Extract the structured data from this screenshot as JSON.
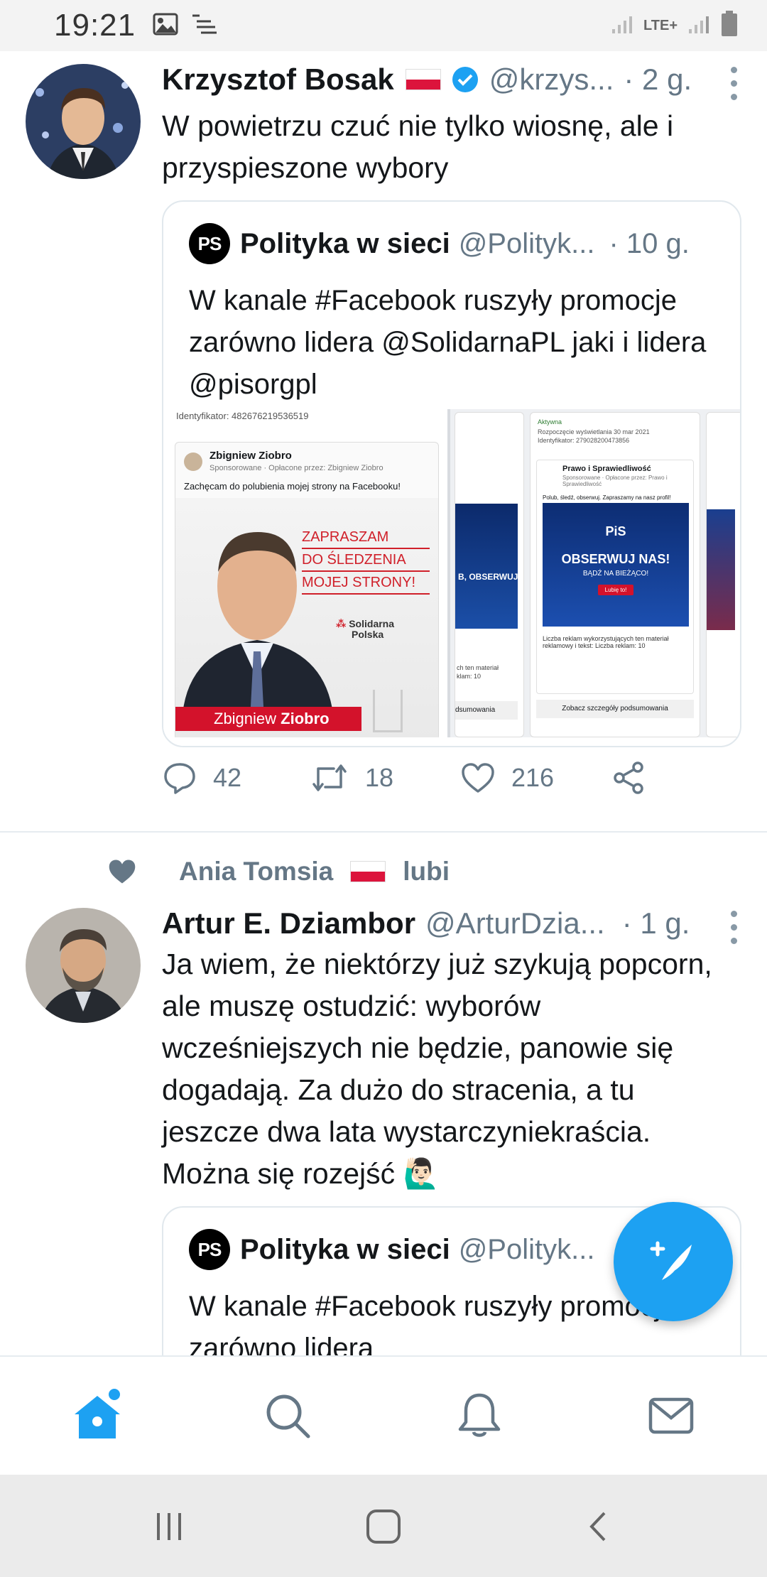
{
  "status_bar": {
    "time": "19:21",
    "network": "LTE+"
  },
  "tweets": [
    {
      "name": "Krzysztof Bosak",
      "handle": "@krzys...",
      "time": "· 2 g.",
      "text": "W powietrzu czuć nie tylko wiosnę, ale i przyspieszone wybory",
      "quote": {
        "name": "Polityka w sieci",
        "handle": "@Polityk...",
        "time": "· 10 g.",
        "logo": "PS",
        "text": "W kanale #Facebook ruszyły promocje zarówno lidera @SolidarnaPL jaki i lidera @pisorgpl",
        "media": {
          "ad1_id": "Identyfikator: 482676219536519",
          "ad1_page": "Zbigniew Ziobro",
          "ad1_sponsored": "Sponsorowane · Opłacone przez: Zbigniew Ziobro",
          "ad1_text": "Zachęcam do polubienia mojej strony na Facebooku!",
          "ad1_banner": [
            "ZAPRASZAM",
            "DO ŚLEDZENIA",
            "MOJEJ STRONY!"
          ],
          "ad1_party": [
            "Solidarna",
            "Polska"
          ],
          "ad1_footer_first": "Zbigniew ",
          "ad1_footer_last": "Ziobro",
          "ad2_button": "B, OBSERWUJ",
          "ad2_footer": "ch ten materiał",
          "ad2_count": "klam: 10",
          "ad2_summary": "dsumowania",
          "ad3_status": "Aktywna",
          "ad3_started": "Rozpoczęcie wyświetlania 30 mar 2021",
          "ad3_id": "Identyfikator: 279028200473856",
          "ad3_page": "Prawo i Sprawiedliwość",
          "ad3_sponsored": "Sponsorowane · Opłacone przez: Prawo i Sprawiedliwość",
          "ad3_text": "Polub, śledź, obserwuj. Zapraszamy na nasz profil!",
          "ad3_logo": "PiS",
          "ad3_headline": "OBSERWUJ NAS!",
          "ad3_sub": "BĄDŹ NA BIEŻĄCO!",
          "ad3_cta": "Lubię to!",
          "ad3_footer": "Liczba reklam wykorzystujących ten materiał reklamowy i tekst: Liczba reklam: 10",
          "ad3_summary": "Zobacz szczegóły podsumowania"
        }
      },
      "replies": "42",
      "retweets": "18",
      "likes": "216"
    },
    {
      "liked_by": "Ania Tomsia",
      "liked_suffix": "lubi",
      "name": "Artur E. Dziambor",
      "handle": "@ArturDzia...",
      "time": "· 1 g.",
      "text": "Ja wiem, że niektórzy już szykują popcorn, ale muszę ostudzić: wyborów wcześniejszych nie będzie, panowie się dogadają. Za dużo do stracenia, a tu jeszcze dwa lata wystarczyniekraścia. Można się rozejść 🙋🏻‍♂️",
      "quote": {
        "name": "Polityka w sieci",
        "handle": "@Polityk...",
        "logo": "PS",
        "text": "W kanale #Facebook ruszyły promocje zarówno lidera"
      }
    }
  ],
  "colors": {
    "accent": "#1da1f2",
    "secondary_text": "#657786",
    "divider": "#e6ecf0"
  },
  "bottom_nav": [
    "home-icon",
    "search-icon",
    "bell-icon",
    "mail-icon"
  ],
  "system_nav": [
    "recents-icon",
    "home-button-icon",
    "back-icon"
  ]
}
